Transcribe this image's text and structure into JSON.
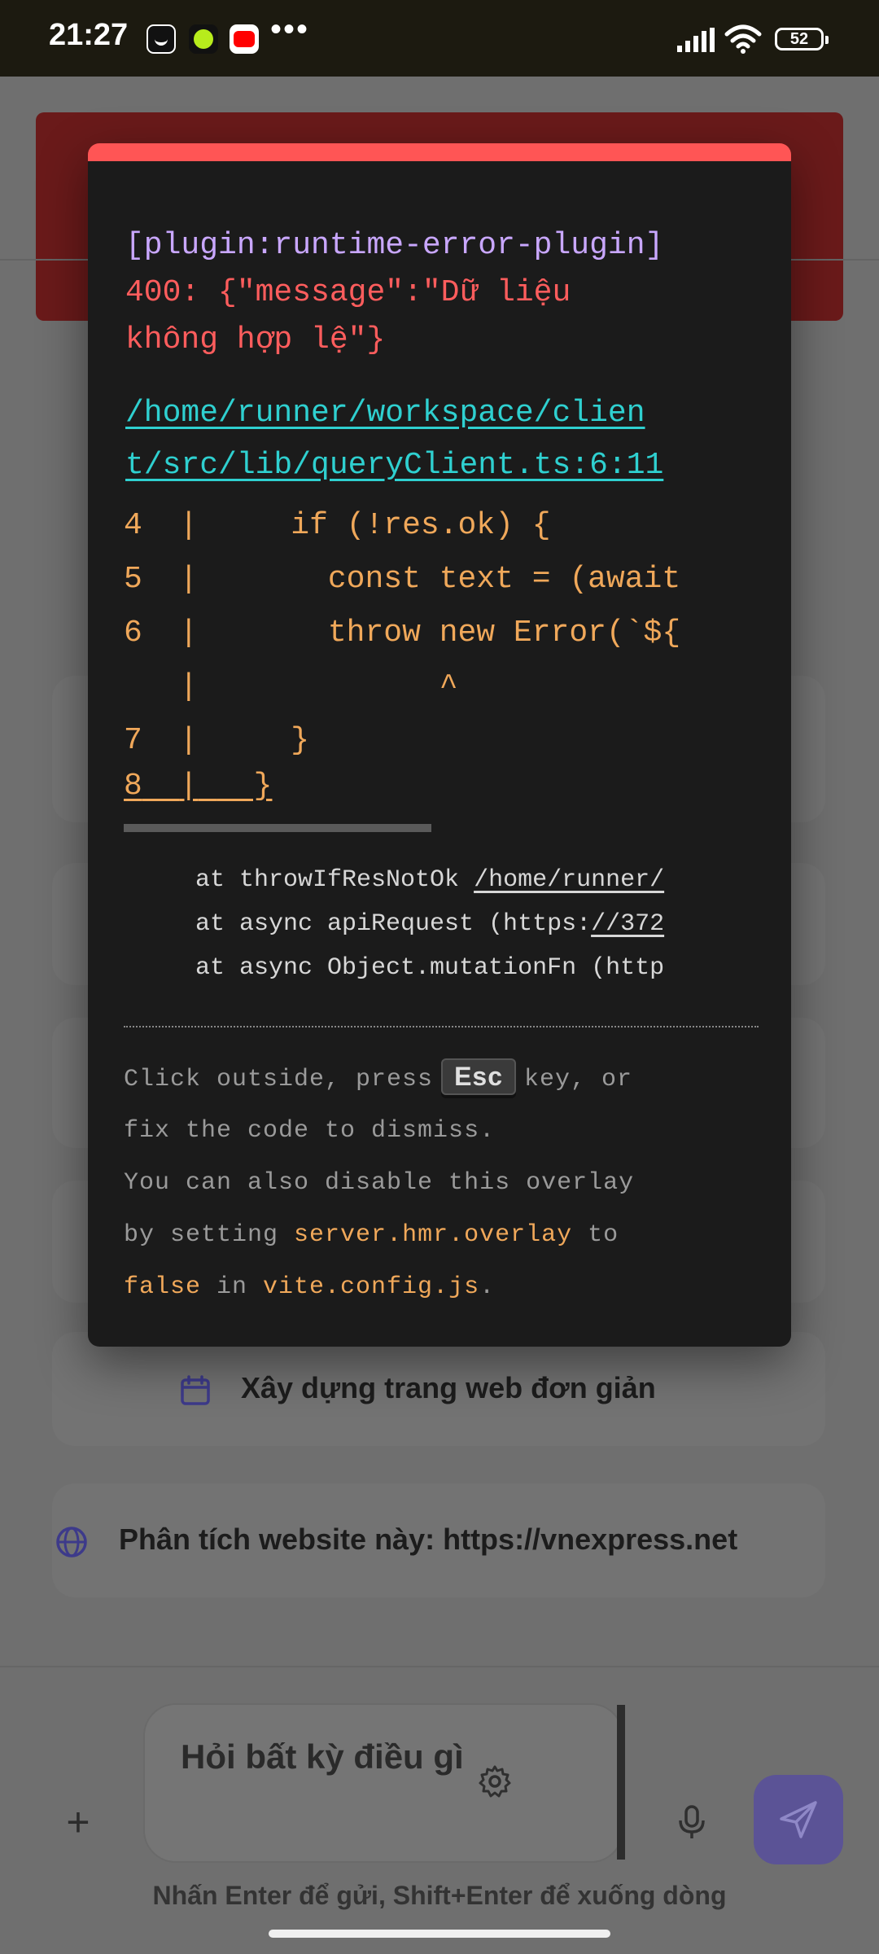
{
  "status_bar": {
    "time": "21:27",
    "battery": "52",
    "icons": [
      "face-app-icon",
      "green-dot-app-icon",
      "youtube-icon",
      "more-icon",
      "signal-icon",
      "wifi-icon",
      "battery-icon"
    ]
  },
  "suggestions": [
    {
      "icon": "calendar-icon",
      "text": "Xây dựng trang web đơn giản"
    },
    {
      "icon": "globe-icon",
      "text": "Phân tích website này: https://vnexpress.net"
    }
  ],
  "composer": {
    "placeholder": "Hỏi bất kỳ điều gì",
    "hint": "Nhấn Enter để gửi, Shift+Enter để xuống dòng"
  },
  "overlay": {
    "plugin": "[plugin:runtime-error-plugin]",
    "message_line1": "400: {\"message\":\"Dữ liệu",
    "message_line2": "không hợp lệ\"}",
    "file_line1": "/home/runner/workspace/clien",
    "file_line2": "t/src/lib/queryClient.ts:6:11",
    "code": [
      {
        "num": "4",
        "bar": "|",
        "text": "    if (!res.ok) {"
      },
      {
        "num": "5",
        "bar": "|",
        "text": "      const text = (await"
      },
      {
        "num": "6",
        "bar": "|",
        "text": "      throw new Error(`${"
      },
      {
        "num": "",
        "bar": "|",
        "text": "            ^"
      },
      {
        "num": "7",
        "bar": "|",
        "text": "    }"
      },
      {
        "num": "8",
        "bar": "|",
        "text": "  }"
      }
    ],
    "stack": [
      {
        "prefix": "at throwIfResNotOk ",
        "link": "/home/runner/"
      },
      {
        "prefix": "at async apiRequest (https:",
        "link": "//372"
      },
      {
        "prefix": "at async Object.mutationFn (http",
        "link": ""
      }
    ],
    "tip": {
      "line1_pre": "Click outside, press",
      "key": "Esc",
      "line1_post": "key, or",
      "line2": "fix the code to dismiss.",
      "line3": "You can also disable this overlay",
      "line4_pre": "by setting ",
      "line4_hl": "server.hmr.overlay",
      "line4_post": " to",
      "line5_hl1": "false",
      "line5_mid": " in ",
      "line5_hl2": "vite.config.js",
      "line5_post": "."
    }
  }
}
